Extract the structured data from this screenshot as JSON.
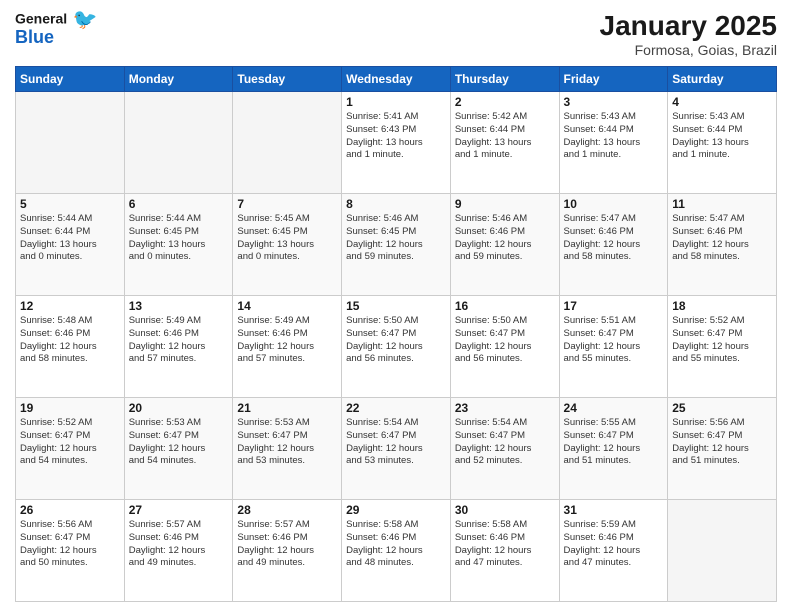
{
  "header": {
    "logo_line1": "General",
    "logo_line2": "Blue",
    "title": "January 2025",
    "subtitle": "Formosa, Goias, Brazil"
  },
  "days_of_week": [
    "Sunday",
    "Monday",
    "Tuesday",
    "Wednesday",
    "Thursday",
    "Friday",
    "Saturday"
  ],
  "weeks": [
    {
      "days": [
        {
          "number": "",
          "detail": ""
        },
        {
          "number": "",
          "detail": ""
        },
        {
          "number": "",
          "detail": ""
        },
        {
          "number": "1",
          "detail": "Sunrise: 5:41 AM\nSunset: 6:43 PM\nDaylight: 13 hours\nand 1 minute."
        },
        {
          "number": "2",
          "detail": "Sunrise: 5:42 AM\nSunset: 6:44 PM\nDaylight: 13 hours\nand 1 minute."
        },
        {
          "number": "3",
          "detail": "Sunrise: 5:43 AM\nSunset: 6:44 PM\nDaylight: 13 hours\nand 1 minute."
        },
        {
          "number": "4",
          "detail": "Sunrise: 5:43 AM\nSunset: 6:44 PM\nDaylight: 13 hours\nand 1 minute."
        }
      ]
    },
    {
      "days": [
        {
          "number": "5",
          "detail": "Sunrise: 5:44 AM\nSunset: 6:44 PM\nDaylight: 13 hours\nand 0 minutes."
        },
        {
          "number": "6",
          "detail": "Sunrise: 5:44 AM\nSunset: 6:45 PM\nDaylight: 13 hours\nand 0 minutes."
        },
        {
          "number": "7",
          "detail": "Sunrise: 5:45 AM\nSunset: 6:45 PM\nDaylight: 13 hours\nand 0 minutes."
        },
        {
          "number": "8",
          "detail": "Sunrise: 5:46 AM\nSunset: 6:45 PM\nDaylight: 12 hours\nand 59 minutes."
        },
        {
          "number": "9",
          "detail": "Sunrise: 5:46 AM\nSunset: 6:46 PM\nDaylight: 12 hours\nand 59 minutes."
        },
        {
          "number": "10",
          "detail": "Sunrise: 5:47 AM\nSunset: 6:46 PM\nDaylight: 12 hours\nand 58 minutes."
        },
        {
          "number": "11",
          "detail": "Sunrise: 5:47 AM\nSunset: 6:46 PM\nDaylight: 12 hours\nand 58 minutes."
        }
      ]
    },
    {
      "days": [
        {
          "number": "12",
          "detail": "Sunrise: 5:48 AM\nSunset: 6:46 PM\nDaylight: 12 hours\nand 58 minutes."
        },
        {
          "number": "13",
          "detail": "Sunrise: 5:49 AM\nSunset: 6:46 PM\nDaylight: 12 hours\nand 57 minutes."
        },
        {
          "number": "14",
          "detail": "Sunrise: 5:49 AM\nSunset: 6:46 PM\nDaylight: 12 hours\nand 57 minutes."
        },
        {
          "number": "15",
          "detail": "Sunrise: 5:50 AM\nSunset: 6:47 PM\nDaylight: 12 hours\nand 56 minutes."
        },
        {
          "number": "16",
          "detail": "Sunrise: 5:50 AM\nSunset: 6:47 PM\nDaylight: 12 hours\nand 56 minutes."
        },
        {
          "number": "17",
          "detail": "Sunrise: 5:51 AM\nSunset: 6:47 PM\nDaylight: 12 hours\nand 55 minutes."
        },
        {
          "number": "18",
          "detail": "Sunrise: 5:52 AM\nSunset: 6:47 PM\nDaylight: 12 hours\nand 55 minutes."
        }
      ]
    },
    {
      "days": [
        {
          "number": "19",
          "detail": "Sunrise: 5:52 AM\nSunset: 6:47 PM\nDaylight: 12 hours\nand 54 minutes."
        },
        {
          "number": "20",
          "detail": "Sunrise: 5:53 AM\nSunset: 6:47 PM\nDaylight: 12 hours\nand 54 minutes."
        },
        {
          "number": "21",
          "detail": "Sunrise: 5:53 AM\nSunset: 6:47 PM\nDaylight: 12 hours\nand 53 minutes."
        },
        {
          "number": "22",
          "detail": "Sunrise: 5:54 AM\nSunset: 6:47 PM\nDaylight: 12 hours\nand 53 minutes."
        },
        {
          "number": "23",
          "detail": "Sunrise: 5:54 AM\nSunset: 6:47 PM\nDaylight: 12 hours\nand 52 minutes."
        },
        {
          "number": "24",
          "detail": "Sunrise: 5:55 AM\nSunset: 6:47 PM\nDaylight: 12 hours\nand 51 minutes."
        },
        {
          "number": "25",
          "detail": "Sunrise: 5:56 AM\nSunset: 6:47 PM\nDaylight: 12 hours\nand 51 minutes."
        }
      ]
    },
    {
      "days": [
        {
          "number": "26",
          "detail": "Sunrise: 5:56 AM\nSunset: 6:47 PM\nDaylight: 12 hours\nand 50 minutes."
        },
        {
          "number": "27",
          "detail": "Sunrise: 5:57 AM\nSunset: 6:46 PM\nDaylight: 12 hours\nand 49 minutes."
        },
        {
          "number": "28",
          "detail": "Sunrise: 5:57 AM\nSunset: 6:46 PM\nDaylight: 12 hours\nand 49 minutes."
        },
        {
          "number": "29",
          "detail": "Sunrise: 5:58 AM\nSunset: 6:46 PM\nDaylight: 12 hours\nand 48 minutes."
        },
        {
          "number": "30",
          "detail": "Sunrise: 5:58 AM\nSunset: 6:46 PM\nDaylight: 12 hours\nand 47 minutes."
        },
        {
          "number": "31",
          "detail": "Sunrise: 5:59 AM\nSunset: 6:46 PM\nDaylight: 12 hours\nand 47 minutes."
        },
        {
          "number": "",
          "detail": ""
        }
      ]
    }
  ]
}
